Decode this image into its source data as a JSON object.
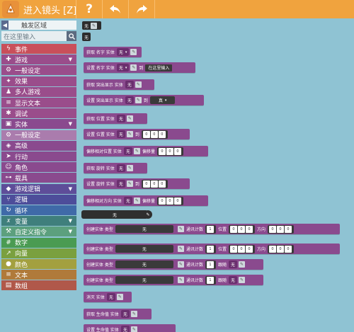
{
  "topbar": {
    "title": "进入镜头 [Z]",
    "help_label": "?",
    "icons": [
      "app-logo-icon",
      "help-icon",
      "undo-icon",
      "redo-icon"
    ]
  },
  "sidebar": {
    "header": "触发区域",
    "search_placeholder": "在这里输入",
    "categories": [
      {
        "label": "事件",
        "color": "#c94f5a",
        "icon": "lightning",
        "expanded": false
      },
      {
        "label": "游戏",
        "color": "#9a4d8b",
        "icon": "gamepad",
        "expanded": true
      },
      {
        "label": "一般设定",
        "color": "#9a4d8b",
        "icon": "settings",
        "expanded": false
      },
      {
        "label": "效果",
        "color": "#9a4d8b",
        "icon": "effect",
        "expanded": false
      },
      {
        "label": "多人游戏",
        "color": "#9a4d8b",
        "icon": "users",
        "expanded": false
      },
      {
        "label": "显示文本",
        "color": "#9a4d8b",
        "icon": "text",
        "expanded": false
      },
      {
        "label": "调试",
        "color": "#9a4d8b",
        "icon": "bug",
        "expanded": false
      },
      {
        "label": "实体",
        "color": "#8a4a8e",
        "icon": "cube",
        "expanded": true
      },
      {
        "label": "一般设定",
        "color": "#aa7cad",
        "icon": "settings",
        "expanded": false
      },
      {
        "label": "高级",
        "color": "#8a4a8e",
        "icon": "advanced",
        "expanded": false
      },
      {
        "label": "行动",
        "color": "#8a4a8e",
        "icon": "action",
        "expanded": false
      },
      {
        "label": "角色",
        "color": "#8a4a8e",
        "icon": "character",
        "expanded": false
      },
      {
        "label": "载具",
        "color": "#8a4a8e",
        "icon": "vehicle",
        "expanded": false
      },
      {
        "label": "游戏逻辑",
        "color": "#5e4d99",
        "icon": "logic",
        "expanded": true
      },
      {
        "label": "逻辑",
        "color": "#4d4d9a",
        "icon": "branch",
        "expanded": false
      },
      {
        "label": "循环",
        "color": "#3f6aa8",
        "icon": "loop",
        "expanded": false
      },
      {
        "label": "变量",
        "color": "#3f7f7c",
        "icon": "variable",
        "expanded": true
      },
      {
        "label": "自定义指令",
        "color": "#5ca07e",
        "icon": "custom",
        "expanded": true
      },
      {
        "label": "数字",
        "color": "#4a9b52",
        "icon": "number",
        "expanded": false
      },
      {
        "label": "向量",
        "color": "#7aa03f",
        "icon": "vector",
        "expanded": false
      },
      {
        "label": "颜色",
        "color": "#a3a03f",
        "icon": "color",
        "expanded": false
      },
      {
        "label": "文本",
        "color": "#b07a3a",
        "icon": "text",
        "expanded": false
      },
      {
        "label": "数组",
        "color": "#b0584a",
        "icon": "array",
        "expanded": false
      }
    ]
  },
  "workspace": {
    "none": "无",
    "zero": "0",
    "blocks": {
      "get_name": "获取 名字 实体",
      "set_name": "设置 名字 实体",
      "to": "到",
      "placeholder_input": "在这里输入",
      "get_highlight": "获取 突出显示 实体",
      "set_highlight": "设置 突出显示 实体",
      "true_value": "真",
      "get_position": "获取 位置 实体",
      "set_position": "设置 位置 实体",
      "offset_position": "偏移相对位置 实体",
      "offset": "偏移量",
      "get_rotation": "获取 旋转 实体",
      "set_rotation": "设置 旋转 实体",
      "offset_direction": "偏移相对方向 实体",
      "create_entity": "创建实体 类型",
      "network_count": "通讯计数",
      "one": "1",
      "position": "位置",
      "direction": "方向",
      "follow": "跟随",
      "destroy": "消灭 实体",
      "get_health": "获取 生命值 实体",
      "set_health": "设置 生命值 实体"
    }
  }
}
